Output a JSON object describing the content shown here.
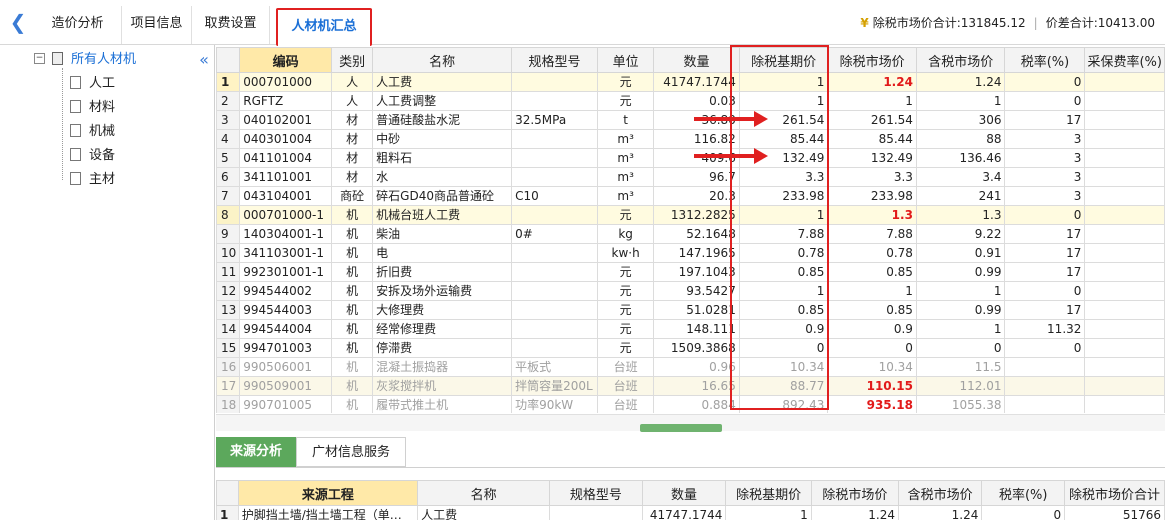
{
  "tabs": [
    {
      "label": "造价分析"
    },
    {
      "label": "项目信息"
    },
    {
      "label": "取费设置"
    },
    {
      "label": "人材机汇总"
    }
  ],
  "summary": {
    "market_total": "除税市场价合计:131845.12",
    "diff_total": "价差合计:10413.00"
  },
  "tree": {
    "root": "所有人材机",
    "children": [
      "人工",
      "材料",
      "机械",
      "设备",
      "主材"
    ]
  },
  "table": {
    "columns": [
      "编码",
      "类别",
      "名称",
      "规格型号",
      "单位",
      "数量",
      "除税基期价",
      "除税市场价",
      "含税市场价",
      "税率(%)",
      "采保费率(%)"
    ],
    "rows": [
      {
        "n": "1",
        "code": "000701000",
        "type": "人",
        "name": "人工费",
        "spec": "",
        "unit": "元",
        "qty": "41747.1744",
        "base": "1",
        "market": "1.24",
        "tax_market": "1.24",
        "rate": "0",
        "fee": ""
      },
      {
        "n": "2",
        "code": "RGFTZ",
        "type": "人",
        "name": "人工费调整",
        "spec": "",
        "unit": "元",
        "qty": "0.03",
        "base": "1",
        "market": "1",
        "tax_market": "1",
        "rate": "0",
        "fee": ""
      },
      {
        "n": "3",
        "code": "040102001",
        "type": "材",
        "name": "普通硅酸盐水泥",
        "spec": "32.5MPa",
        "unit": "t",
        "qty": "36.80",
        "base": "261.54",
        "market": "261.54",
        "tax_market": "306",
        "rate": "17",
        "fee": ""
      },
      {
        "n": "4",
        "code": "040301004",
        "type": "材",
        "name": "中砂",
        "spec": "",
        "unit": "m³",
        "qty": "116.82",
        "base": "85.44",
        "market": "85.44",
        "tax_market": "88",
        "rate": "3",
        "fee": ""
      },
      {
        "n": "5",
        "code": "041101004",
        "type": "材",
        "name": "粗料石",
        "spec": "",
        "unit": "m³",
        "qty": "409.6",
        "base": "132.49",
        "market": "132.49",
        "tax_market": "136.46",
        "rate": "3",
        "fee": ""
      },
      {
        "n": "6",
        "code": "341101001",
        "type": "材",
        "name": "水",
        "spec": "",
        "unit": "m³",
        "qty": "96.7",
        "base": "3.3",
        "market": "3.3",
        "tax_market": "3.4",
        "rate": "3",
        "fee": ""
      },
      {
        "n": "7",
        "code": "043104001",
        "type": "商砼",
        "name": "碎石GD40商品普通砼",
        "spec": "C10",
        "unit": "m³",
        "qty": "20.3",
        "base": "233.98",
        "market": "233.98",
        "tax_market": "241",
        "rate": "3",
        "fee": ""
      },
      {
        "n": "8",
        "code": "000701000-1",
        "type": "机",
        "name": "机械台班人工费",
        "spec": "",
        "unit": "元",
        "qty": "1312.2825",
        "base": "1",
        "market": "1.3",
        "tax_market": "1.3",
        "rate": "0",
        "fee": ""
      },
      {
        "n": "9",
        "code": "140304001-1",
        "type": "机",
        "name": "柴油",
        "spec": "0#",
        "unit": "kg",
        "qty": "52.1648",
        "base": "7.88",
        "market": "7.88",
        "tax_market": "9.22",
        "rate": "17",
        "fee": ""
      },
      {
        "n": "10",
        "code": "341103001-1",
        "type": "机",
        "name": "电",
        "spec": "",
        "unit": "kw·h",
        "qty": "147.1965",
        "base": "0.78",
        "market": "0.78",
        "tax_market": "0.91",
        "rate": "17",
        "fee": ""
      },
      {
        "n": "11",
        "code": "992301001-1",
        "type": "机",
        "name": "折旧费",
        "spec": "",
        "unit": "元",
        "qty": "197.1043",
        "base": "0.85",
        "market": "0.85",
        "tax_market": "0.99",
        "rate": "17",
        "fee": ""
      },
      {
        "n": "12",
        "code": "994544002",
        "type": "机",
        "name": "安拆及场外运输费",
        "spec": "",
        "unit": "元",
        "qty": "93.5427",
        "base": "1",
        "market": "1",
        "tax_market": "1",
        "rate": "0",
        "fee": ""
      },
      {
        "n": "13",
        "code": "994544003",
        "type": "机",
        "name": "大修理费",
        "spec": "",
        "unit": "元",
        "qty": "51.0281",
        "base": "0.85",
        "market": "0.85",
        "tax_market": "0.99",
        "rate": "17",
        "fee": ""
      },
      {
        "n": "14",
        "code": "994544004",
        "type": "机",
        "name": "经常修理费",
        "spec": "",
        "unit": "元",
        "qty": "148.111",
        "base": "0.9",
        "market": "0.9",
        "tax_market": "1",
        "rate": "11.32",
        "fee": ""
      },
      {
        "n": "15",
        "code": "994701003",
        "type": "机",
        "name": "停滞费",
        "spec": "",
        "unit": "元",
        "qty": "1509.3868",
        "base": "0",
        "market": "0",
        "tax_market": "0",
        "rate": "0",
        "fee": ""
      },
      {
        "n": "16",
        "code": "990506001",
        "type": "机",
        "name": "混凝土振捣器",
        "spec": "平板式",
        "unit": "台班",
        "qty": "0.96",
        "base": "10.34",
        "market": "10.34",
        "tax_market": "11.5",
        "rate": "",
        "fee": ""
      },
      {
        "n": "17",
        "code": "990509001",
        "type": "机",
        "name": "灰浆搅拌机",
        "spec": "拌筒容量200L",
        "unit": "台班",
        "qty": "16.65",
        "base": "88.77",
        "market": "110.15",
        "tax_market": "112.01",
        "rate": "",
        "fee": ""
      },
      {
        "n": "18",
        "code": "990701005",
        "type": "机",
        "name": "履带式推土机",
        "spec": "功率90kW",
        "unit": "台班",
        "qty": "0.884",
        "base": "892.43",
        "market": "935.18",
        "tax_market": "1055.38",
        "rate": "",
        "fee": ""
      }
    ]
  },
  "bottom_tabs": [
    {
      "label": "来源分析"
    },
    {
      "label": "广材信息服务"
    }
  ],
  "source_table": {
    "columns": [
      "来源工程",
      "名称",
      "规格型号",
      "数量",
      "除税基期价",
      "除税市场价",
      "含税市场价",
      "税率(%)",
      "除税市场价合计"
    ],
    "rows": [
      {
        "n": "1",
        "proj": "护脚挡土墙/挡土墙工程（单…",
        "name": "人工费",
        "spec": "",
        "qty": "41747.1744",
        "base": "1",
        "market": "1.24",
        "tax_market": "1.24",
        "rate": "0",
        "total": "51766"
      }
    ]
  }
}
